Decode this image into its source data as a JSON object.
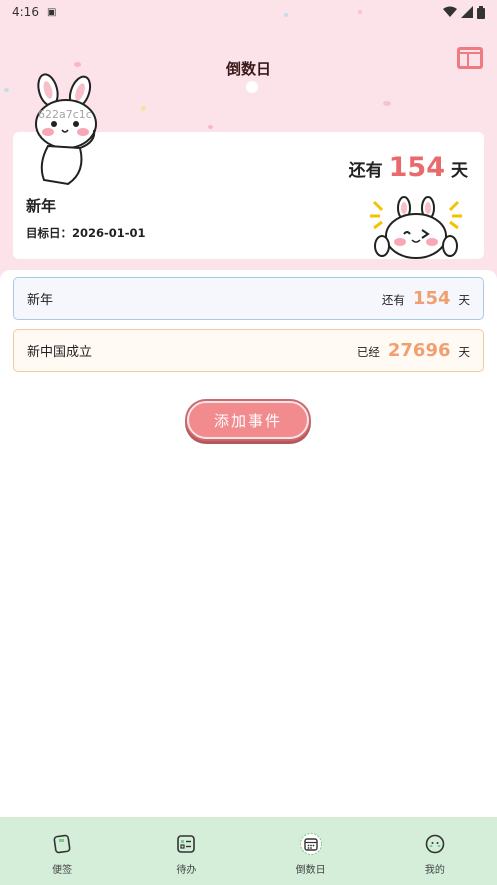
{
  "status_bar": {
    "time": "4:16",
    "icons": [
      "android-icon",
      "wifi-icon",
      "signal-icon",
      "battery-icon"
    ]
  },
  "header": {
    "title": "倒数日",
    "action_icon": "layout-icon"
  },
  "hero": {
    "prefix": "还有",
    "days": "154",
    "unit": "天",
    "name": "新年",
    "target_date": "目标日：2026-01-01",
    "watermark": "622a7c1c"
  },
  "events": [
    {
      "name": "新年",
      "prefix": "还有",
      "days": "154",
      "unit": "天"
    },
    {
      "name": "新中国成立",
      "prefix": "已经",
      "days": "27696",
      "unit": "天"
    }
  ],
  "add_button": {
    "label": "添加事件"
  },
  "bottom_nav": [
    {
      "label": "便签",
      "icon": "notes-icon"
    },
    {
      "label": "待办",
      "icon": "todo-icon"
    },
    {
      "label": "倒数日",
      "icon": "calendar-icon"
    },
    {
      "label": "我的",
      "icon": "profile-icon"
    }
  ],
  "colors": {
    "header_bg": "#fbe3e9",
    "accent_red": "#e96a6a",
    "accent_orange": "#f0a070",
    "button_pink": "#f18b8e",
    "nav_bg": "#d4eed9",
    "layout_icon": "#f07a82"
  }
}
